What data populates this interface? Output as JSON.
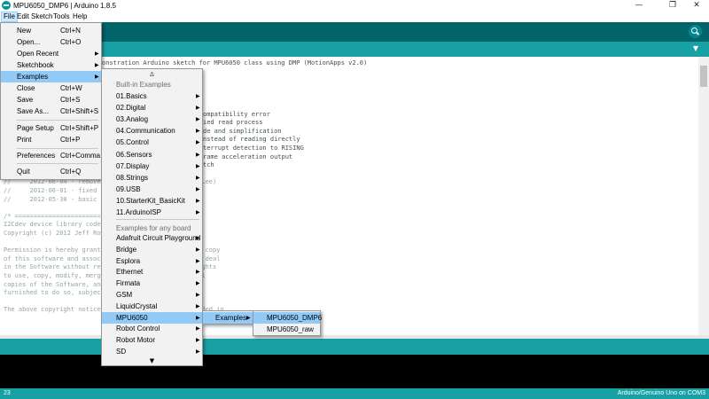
{
  "window": {
    "title": "MPU6050_DMP6 | Arduino 1.8.5",
    "min_glyph": "—",
    "max_glyph": "❐",
    "close_glyph": "✕"
  },
  "menubar": {
    "items": [
      "File",
      "Edit",
      "Sketch",
      "Tools",
      "Help"
    ],
    "active": "File"
  },
  "toolbar": {
    "serial_monitor_icon": "magnifier-icon",
    "tab_menu_glyph": "▼"
  },
  "file_menu": {
    "items": [
      {
        "label": "New",
        "shortcut": "Ctrl+N"
      },
      {
        "label": "Open...",
        "shortcut": "Ctrl+O"
      },
      {
        "label": "Open Recent",
        "shortcut": "",
        "submenu": true
      },
      {
        "label": "Sketchbook",
        "shortcut": "",
        "submenu": true
      },
      {
        "label": "Examples",
        "shortcut": "",
        "submenu": true,
        "highlighted": true
      },
      {
        "label": "Close",
        "shortcut": "Ctrl+W"
      },
      {
        "label": "Save",
        "shortcut": "Ctrl+S"
      },
      {
        "label": "Save As...",
        "shortcut": "Ctrl+Shift+S"
      },
      {
        "label": "Page Setup",
        "shortcut": "Ctrl+Shift+P"
      },
      {
        "label": "Print",
        "shortcut": "Ctrl+P"
      },
      {
        "label": "Preferences",
        "shortcut": "Ctrl+Comma"
      },
      {
        "label": "Quit",
        "shortcut": "Ctrl+Q"
      }
    ]
  },
  "examples_menu": {
    "scroll_up": "∆",
    "scroll_down": "▼",
    "builtin_header": "Built-in Examples",
    "builtin": [
      "01.Basics",
      "02.Digital",
      "03.Analog",
      "04.Communication",
      "05.Control",
      "06.Sensors",
      "07.Display",
      "08.Strings",
      "09.USB",
      "10.StarterKit_BasicKit",
      "11.ArduinoISP"
    ],
    "board_header": "Examples for any board",
    "board": [
      "Adafruit Circuit Playground",
      "Bridge",
      "Esplora",
      "Ethernet",
      "Firmata",
      "GSM",
      "LiquidCrystal",
      "MPU6050",
      "Robot Control",
      "Robot Motor",
      "SD"
    ],
    "highlighted": "MPU6050"
  },
  "mpu_menu": {
    "items": [
      "Examples"
    ],
    "highlighted": "Examples"
  },
  "mpu_examples_menu": {
    "items": [
      "MPU6050_DMP6",
      "MPU6050_raw"
    ],
    "highlighted": "MPU6050_DMP6"
  },
  "editor": {
    "lines": [
      "onstration Arduino sketch for MPU6050 class using DMP (MotionApps v2.0)",
      "",
      "hub.com/jrowberg/i2cdevlib",
      "",
      "",
      "",
      "ompatibility error",
      "ied read process",
      "de and simplification",
      "nstead of reading directly",
      "terrupt detection to RISING",
      "rame acceleration output",
      "tch",
      "//                 - add Euler    formats",
      "//     2012-06-04 - remove acc   uits (thanks Sungon Lee)",
      "//     2012-06-01 - fixed gyro   nstead of 250",
      "//     2012-05-30 - basic DMP",
      "",
      "/* ============================",
      "I2Cdev device library code is p",
      "Copyright (c) 2012 Jeff Rowberg",
      "",
      "Permission is hereby granted, f              aining a copy",
      "of this software and associated              re\"), to deal",
      "in the Software without restric              n the rights",
      "to use, copy, modify, merge, pu              d/or sell",
      "copies of the Software, and to               rk is",
      "furnished to do so, subject to",
      "",
      "The above copyright notice and                  included in"
    ]
  },
  "status": {
    "line_number": "23",
    "board": "Arduino/Genuino Uno on COM3"
  }
}
